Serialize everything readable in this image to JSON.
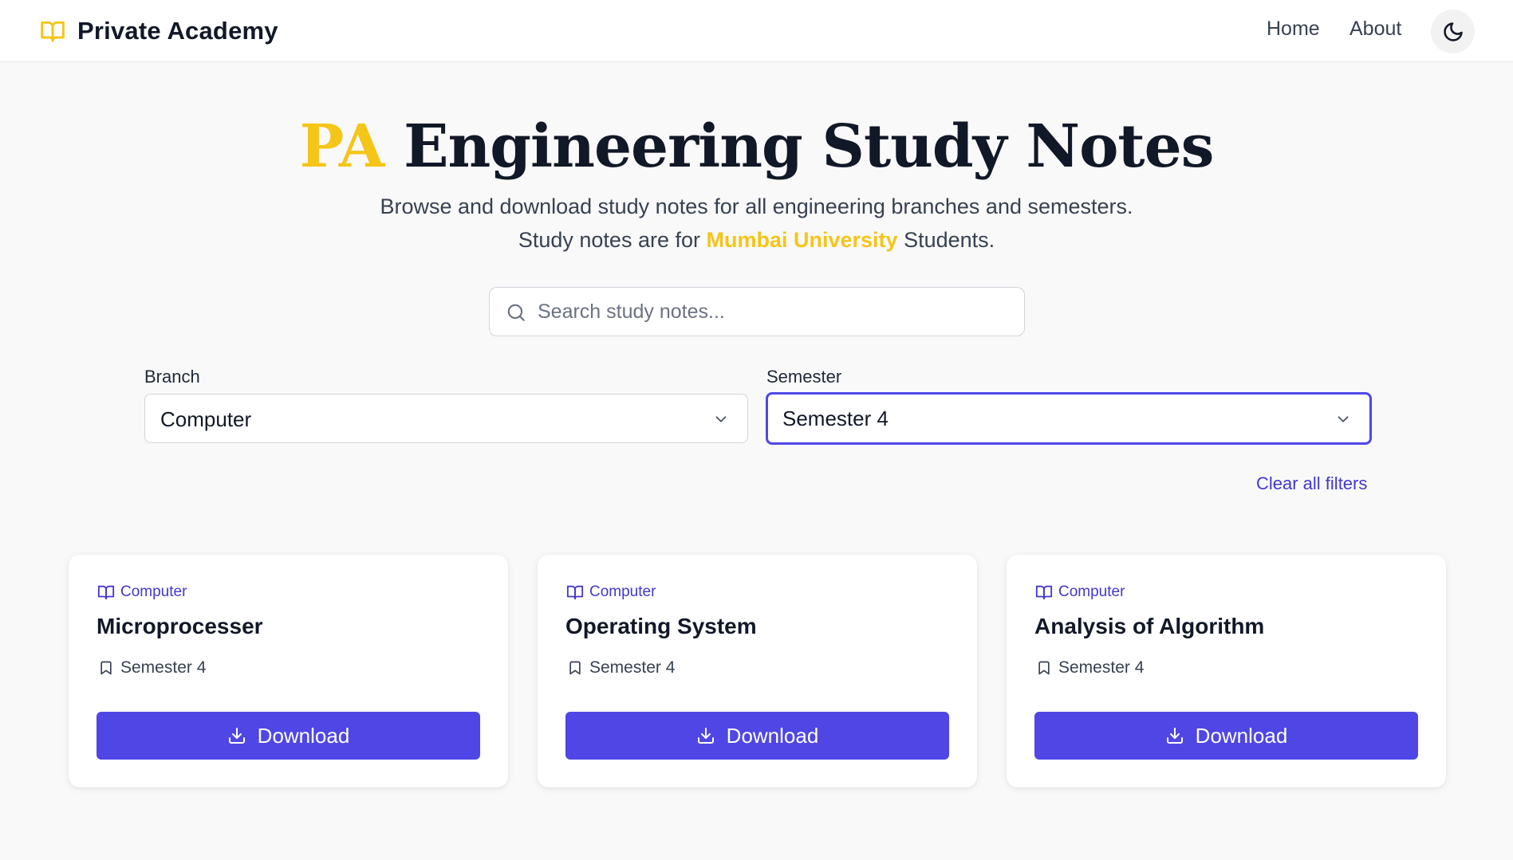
{
  "colors": {
    "accent_yellow": "#f5c518",
    "primary": "#4f46e5",
    "primary_text": "#4338ca",
    "focus_ring": "#5048e5",
    "background": "#f9f9fa"
  },
  "header": {
    "brand_icon": "book-open-icon",
    "brand_name": "Private Academy",
    "nav": {
      "home": "Home",
      "about": "About"
    },
    "theme_toggle_icon": "moon-icon"
  },
  "hero": {
    "title_accent": "PA",
    "title_rest": "Engineering Study Notes",
    "subtitle_line1": "Browse and download study notes for all engineering branches and semesters.",
    "subtitle_line2_prefix": "Study notes are for",
    "subtitle_line2_highlight": "Mumbai University",
    "subtitle_line2_suffix": "Students."
  },
  "search": {
    "icon": "search-icon",
    "placeholder": "Search study notes...",
    "value": ""
  },
  "filters": {
    "branch": {
      "label": "Branch",
      "value": "Computer"
    },
    "semester": {
      "label": "Semester",
      "value": "Semester 4"
    },
    "clear_label": "Clear all filters"
  },
  "notes": [
    {
      "branch": "Computer",
      "title": "Microprocesser",
      "semester": "Semester 4",
      "download_label": "Download"
    },
    {
      "branch": "Computer",
      "title": "Operating System",
      "semester": "Semester 4",
      "download_label": "Download"
    },
    {
      "branch": "Computer",
      "title": "Analysis of Algorithm",
      "semester": "Semester 4",
      "download_label": "Download"
    }
  ]
}
